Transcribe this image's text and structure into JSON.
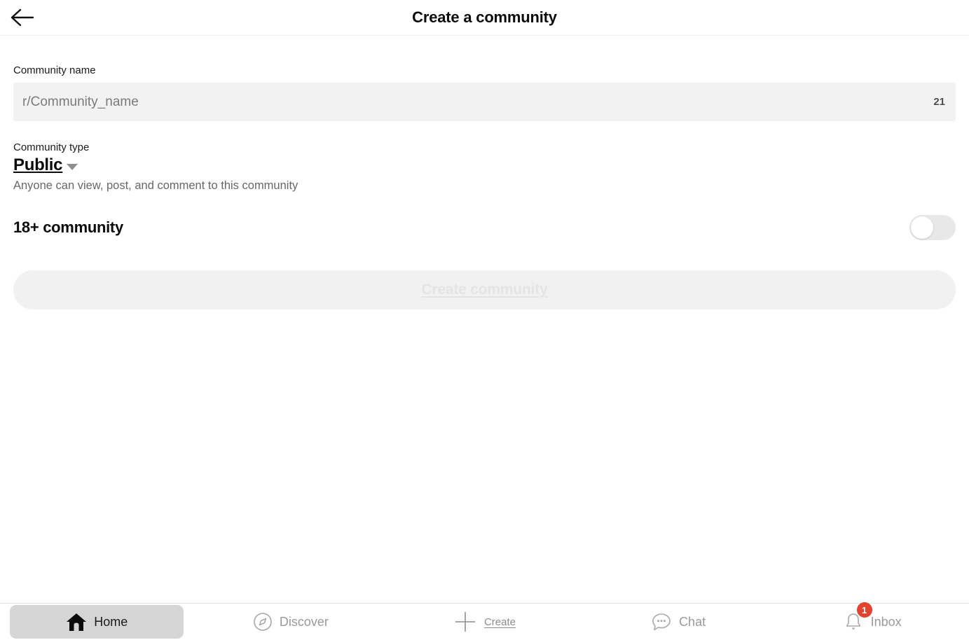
{
  "header": {
    "back_icon": "arrow-left-icon",
    "title": "Create a community"
  },
  "form": {
    "name_label": "Community name",
    "name_placeholder": "r/Community_name",
    "name_value": "",
    "char_count": "21",
    "type_label": "Community type",
    "type_value": "Public",
    "type_caret_icon": "chevron-down-icon",
    "type_description": "Anyone can view, post, and comment to this community",
    "nsfw_label": "18+ community",
    "nsfw_enabled": "off",
    "submit_label": "Create community",
    "submit_disabled": "true"
  },
  "bottom_nav": {
    "items": [
      {
        "label": "Home",
        "icon": "home-icon",
        "active": "true",
        "badge": ""
      },
      {
        "label": "Discover",
        "icon": "compass-icon",
        "active": "false",
        "badge": ""
      },
      {
        "label": "Create",
        "icon": "plus-icon",
        "active": "false",
        "badge": ""
      },
      {
        "label": "Chat",
        "icon": "chat-bubble-icon",
        "active": "false",
        "badge": ""
      },
      {
        "label": "Inbox",
        "icon": "bell-icon",
        "active": "false",
        "badge": "1"
      }
    ]
  },
  "colors": {
    "badge_red": "#e2442f",
    "field_bg": "#f2f2f2",
    "active_pill": "#d5d5d5"
  }
}
